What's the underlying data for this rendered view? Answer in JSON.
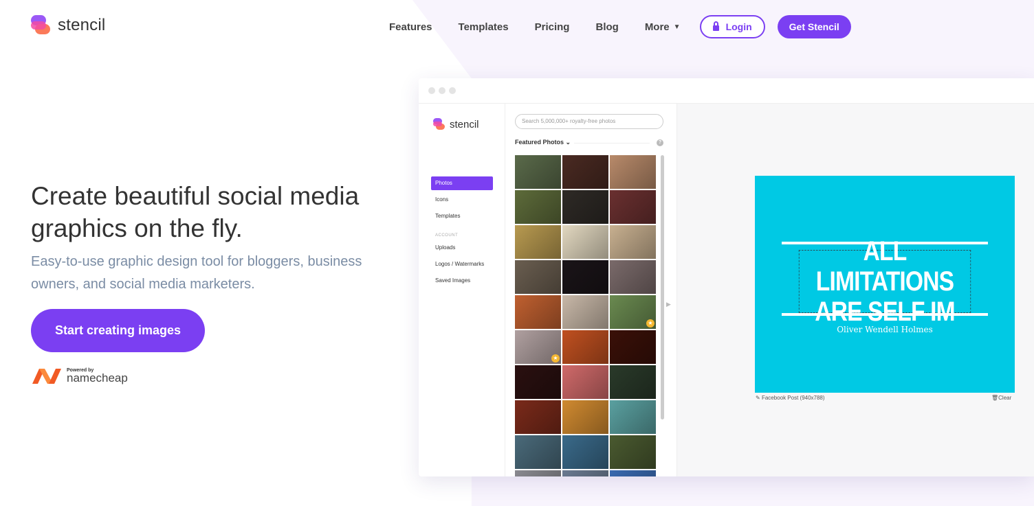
{
  "brand": {
    "name": "stencil"
  },
  "nav": {
    "items": [
      "Features",
      "Templates",
      "Pricing",
      "Blog"
    ],
    "more": "More",
    "login": "Login",
    "get_stencil": "Get Stencil"
  },
  "hero": {
    "title": "Create beautiful social media graphics on the fly.",
    "subtitle": "Easy-to-use graphic design tool for bloggers, business owners, and social media marketers.",
    "cta": "Start creating images",
    "powered_by": "Powered by",
    "powered_brand": "namecheap"
  },
  "app": {
    "brand": "stencil",
    "sidebar": {
      "items": [
        "Photos",
        "Icons",
        "Templates"
      ],
      "section": "ACCOUNT",
      "account_items": [
        "Uploads",
        "Logos / Watermarks",
        "Saved Images"
      ]
    },
    "search_placeholder": "Search 5,000,000+ royalty-free photos",
    "featured_label": "Featured Photos",
    "help": "?",
    "thumb_colors": [
      "#5a6a4a",
      "#4a2a22",
      "#b88a6a",
      "#5d6b3a",
      "#2e2a26",
      "#6a3030",
      "#b89a50",
      "#e2d8c0",
      "#c8b090",
      "#6a5e50",
      "#1a1418",
      "#7a6a6a",
      "#c06030",
      "#c8b8a8",
      "#6a8a50",
      "#b0a0a0",
      "#c05020",
      "#3a1008",
      "#2a1010",
      "#d06a6a",
      "#2a3a2a",
      "#7a2a1a",
      "#d08a30",
      "#5aa0a0",
      "#4a6a7a",
      "#3a6a8a",
      "#4a5a30",
      "#8a8a90",
      "#6a7a90",
      "#3a6ab0"
    ],
    "starred": [
      14,
      15
    ],
    "canvas": {
      "bg": "#00c9e4",
      "quote_line1": "ALL LIMITATIONS",
      "quote_line2": "ARE SELF IM",
      "author": "Oliver Wendell Holmes",
      "size_label": "Facebook Post (940x788)",
      "clear": "Clear"
    }
  }
}
